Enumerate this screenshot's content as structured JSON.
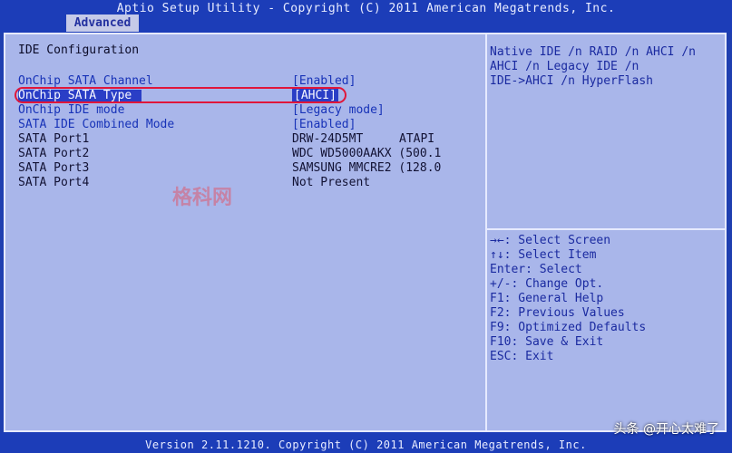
{
  "header": {
    "title": "Aptio Setup Utility - Copyright (C) 2011 American Megatrends, Inc.",
    "tab": "Advanced"
  },
  "section": {
    "title": "IDE Configuration"
  },
  "settings": [
    {
      "label": "OnChip SATA Channel",
      "value": "[Enabled]",
      "extra": ""
    },
    {
      "label": "OnChip SATA Type",
      "value": "[AHCI]",
      "extra": ""
    },
    {
      "label": "OnChip IDE mode",
      "value": "[Legacy mode]",
      "extra": ""
    },
    {
      "label": "SATA IDE Combined Mode",
      "value": "[Enabled]",
      "extra": ""
    },
    {
      "label": "SATA Port1",
      "value": "DRW-24D5MT",
      "extra": "ATAPI"
    },
    {
      "label": "SATA Port2",
      "value": "WDC WD5000AAKX (500.1",
      "extra": ""
    },
    {
      "label": "SATA Port3",
      "value": "SAMSUNG MMCRE2 (128.0",
      "extra": ""
    },
    {
      "label": "SATA Port4",
      "value": "Not Present",
      "extra": ""
    }
  ],
  "help": {
    "lines": [
      "Native IDE /n RAID /n AHCI /n",
      "AHCI /n Legacy IDE /n",
      "IDE->AHCI /n HyperFlash"
    ]
  },
  "keys": [
    "→←: Select Screen",
    "↑↓: Select Item",
    "Enter: Select",
    "+/-: Change Opt.",
    "F1: General Help",
    "F2: Previous Values",
    "F9: Optimized Defaults",
    "F10: Save & Exit",
    "ESC: Exit"
  ],
  "watermark": "格科网",
  "footer": {
    "text": "Version 2.11.1210. Copyright (C) 2011 American Megatrends, Inc."
  },
  "attribution": "头条 @开心太难了",
  "colors": {
    "background": "#1f3fb0",
    "panel": "#a9b6ea",
    "selected": "#2a3ec6",
    "highlight": "#e0163a"
  }
}
